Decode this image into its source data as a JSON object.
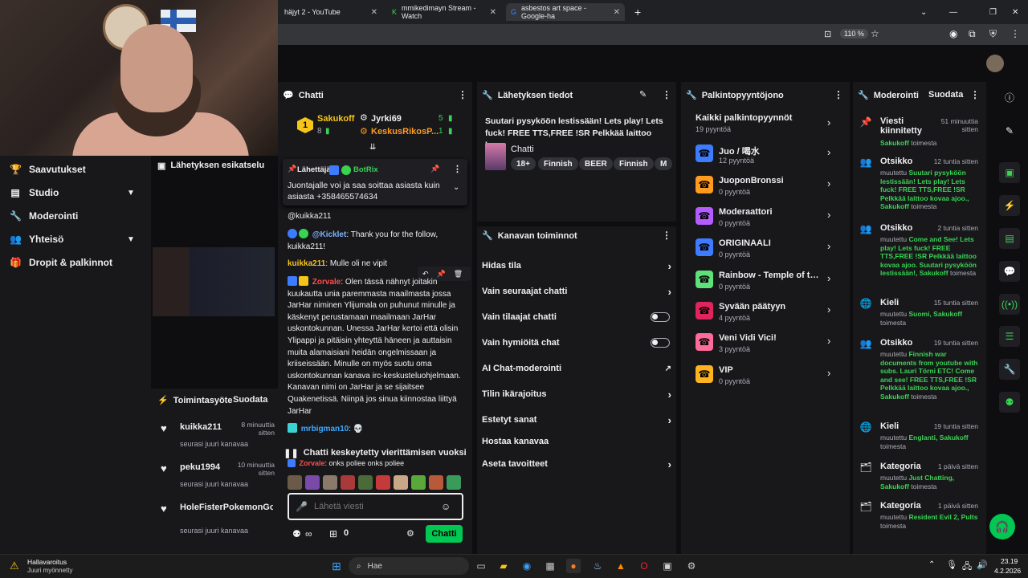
{
  "browser": {
    "tabs": [
      {
        "label": "häjyt 2 - YouTube"
      },
      {
        "label": "mmikedimayn Stream - Watch"
      },
      {
        "label": "asbestos art space - Google-ha"
      }
    ],
    "zoom": "110 %"
  },
  "leftnav": {
    "items": [
      {
        "label": "Saavutukset"
      },
      {
        "label": "Studio"
      },
      {
        "label": "Moderointi"
      },
      {
        "label": "Yhteisö"
      },
      {
        "label": "Dropit & palkinnot"
      }
    ]
  },
  "preview": {
    "title": "Lähetyksen esikatselu"
  },
  "activity": {
    "title": "Toimintasyöte",
    "filter": "Suodata",
    "items": [
      {
        "user": "kuikka211",
        "time": "8 minuuttia sitten",
        "text": "seurasi juuri kanavaa"
      },
      {
        "user": "peku1994",
        "time": "10 minuuttia sitten",
        "text": "seurasi juuri kanavaa"
      },
      {
        "user": "HoleFisterPokemonGo",
        "time": "",
        "text": "seurasi juuri kanavaa"
      }
    ]
  },
  "chat": {
    "title": "Chatti",
    "leaders": [
      {
        "rank": "1",
        "name": "Sakukoff",
        "count": "8"
      },
      {
        "rank": "",
        "name": "Jyrki69",
        "count": "5"
      },
      {
        "rank": "",
        "name": "KeskusRikosP...",
        "count": "1"
      }
    ],
    "pinned": {
      "label": "Lähettäjä",
      "user": "BotRix",
      "text": "Juontajalle voi ja saa soittaa asiasta kuin asiasta +358465574634"
    },
    "messages": [
      {
        "text": "@kuikka211"
      },
      {
        "user": "@Kicklet",
        "text": "Thank you for the follow, kuikka211!"
      },
      {
        "user": "kuikka211",
        "text": "Mulle oli ne vipit"
      },
      {
        "user": "Zorvale",
        "text": "Olen tässä nähnyt joitakin kuukautta unia paremmasta maailmasta jossa JarHar niminen Ylijumala on puhunut minulle ja käskenyt perustamaan maailmaan JarHar uskontokunnan. Unessa JarHar kertoi että olisin Ylipappi ja pitäisin yhteyttä häneen ja auttaisin muita alamaisiani heidän ongelmissaan ja kriiseissään. Minulle on myös suotu oma uskontokunnan kanava irc-keskusteluohjelmaan. Kanavan nimi on JarHar ja se sijaitsee Quakenetissä. Niinpä jos sinua kiinnostaa liittyä JarHar"
      },
      {
        "user": "mrbigman10",
        "text": ""
      },
      {
        "user": "Zorvale",
        "text": "onks poliee onks poliee"
      }
    ],
    "paused": "Chatti keskeytetty vierittämisen vuoksi",
    "input_placeholder": "Lähetä viesti",
    "points": "0",
    "send_label": "Chatti"
  },
  "stream_info": {
    "title": "Lähetyksen tiedot",
    "stream_title": "Suutari pysyköön lestissään! Lets play! Lets fuck! FREE TTS,FREE !SR Pelkkää laittoo kov...",
    "category": "Chatti",
    "tags": [
      "18+",
      "Finnish",
      "BEER",
      "Finnish",
      "M"
    ]
  },
  "channel_actions": {
    "title": "Kanavan toiminnot",
    "items": [
      {
        "label": "Hidas tila"
      },
      {
        "label": "Vain seuraajat chatti"
      },
      {
        "label": "Vain tilaajat chatti"
      },
      {
        "label": "Vain hymiöitä chat"
      },
      {
        "label": "AI Chat-moderointi"
      },
      {
        "label": "Tilin ikärajoitus"
      },
      {
        "label": "Estetyt sanat"
      },
      {
        "label": "Hostaa kanavaa"
      },
      {
        "label": "Aseta tavoitteet"
      }
    ]
  },
  "rewards": {
    "title": "Palkintopyyntöjono",
    "all": {
      "label": "Kaikki palkintopyynnöt",
      "count": "19 pyyntöä"
    },
    "items": [
      {
        "label": "Juo / 喝水",
        "count": "12 pyyntöä",
        "color": "#3d7bff"
      },
      {
        "label": "JuoponBronssi",
        "count": "0 pyyntöä",
        "color": "#ff9b1f"
      },
      {
        "label": "Moderaattori",
        "count": "0 pyyntöä",
        "color": "#b35cff"
      },
      {
        "label": "ORIGINAALI",
        "count": "0 pyyntöä",
        "color": "#3d7bff"
      },
      {
        "label": "Rainbow - Temple of th...",
        "count": "0 pyyntöä",
        "color": "#5ee07a"
      },
      {
        "label": "Syvään päätyyn",
        "count": "4 pyyntöä",
        "color": "#e0245e"
      },
      {
        "label": "Veni Vidi Vici!",
        "count": "3 pyyntöä",
        "color": "#ff6b9a"
      },
      {
        "label": "VIP",
        "count": "0 pyyntöä",
        "color": "#ffb31f"
      }
    ]
  },
  "moderation": {
    "title": "Moderointi",
    "filter": "Suodata",
    "items": [
      {
        "type": "Viesti kiinnitetty",
        "time": "51 minuuttia sitten",
        "who": "Sakukoff",
        "pre": "",
        "value": "",
        "post": "toimesta"
      },
      {
        "type": "Otsikko",
        "time": "12 tuntia sitten",
        "who": "Sakukoff",
        "pre": "muutettu",
        "value": "Suutari pysyköön lestissään! Lets play! Lets fuck! FREE TTS,FREE !SR Pelkkää laittoo kovaa ajoo.,",
        "post": "toimesta"
      },
      {
        "type": "Otsikko",
        "time": "2 tuntia sitten",
        "who": "Sakukoff",
        "pre": "muutettu",
        "value": "Come and See! Lets play! Lets fuck! FREE TTS,FREE !SR Pelkkää laittoo kovaa ajoo. Suutari pysyköön lestissään!,",
        "post": "toimesta"
      },
      {
        "type": "Kieli",
        "time": "15 tuntia sitten",
        "who": "Sakukoff",
        "pre": "muutettu",
        "value": "Suomi,",
        "post": "toimesta"
      },
      {
        "type": "Otsikko",
        "time": "19 tuntia sitten",
        "who": "Sakukoff",
        "pre": "muutettu",
        "value": "Finnish war documents from youtube with subs. Lauri Törni ETC! Come and see! FREE TTS,FREE !SR Pelkkää laittoo kovaa ajoo.,",
        "post": "toimesta"
      },
      {
        "type": "Kieli",
        "time": "19 tuntia sitten",
        "who": "Sakukoff",
        "pre": "muutettu",
        "value": "Englanti,",
        "post": "toimesta"
      },
      {
        "type": "Kategoria",
        "time": "1 päivä sitten",
        "who": "Sakukoff",
        "pre": "muutettu",
        "value": "Just Chatting,",
        "post": "toimesta"
      },
      {
        "type": "Kategoria",
        "time": "1 päivä sitten",
        "who": "Pults",
        "pre": "muutettu",
        "value": "Resident Evil 2,",
        "post": "toimesta"
      }
    ]
  },
  "taskbar": {
    "weather_title": "Hallavaroitus",
    "weather_sub": "Juuri myönnetty",
    "search": "Hae",
    "time": "23.19",
    "date": "4.2.2026"
  }
}
